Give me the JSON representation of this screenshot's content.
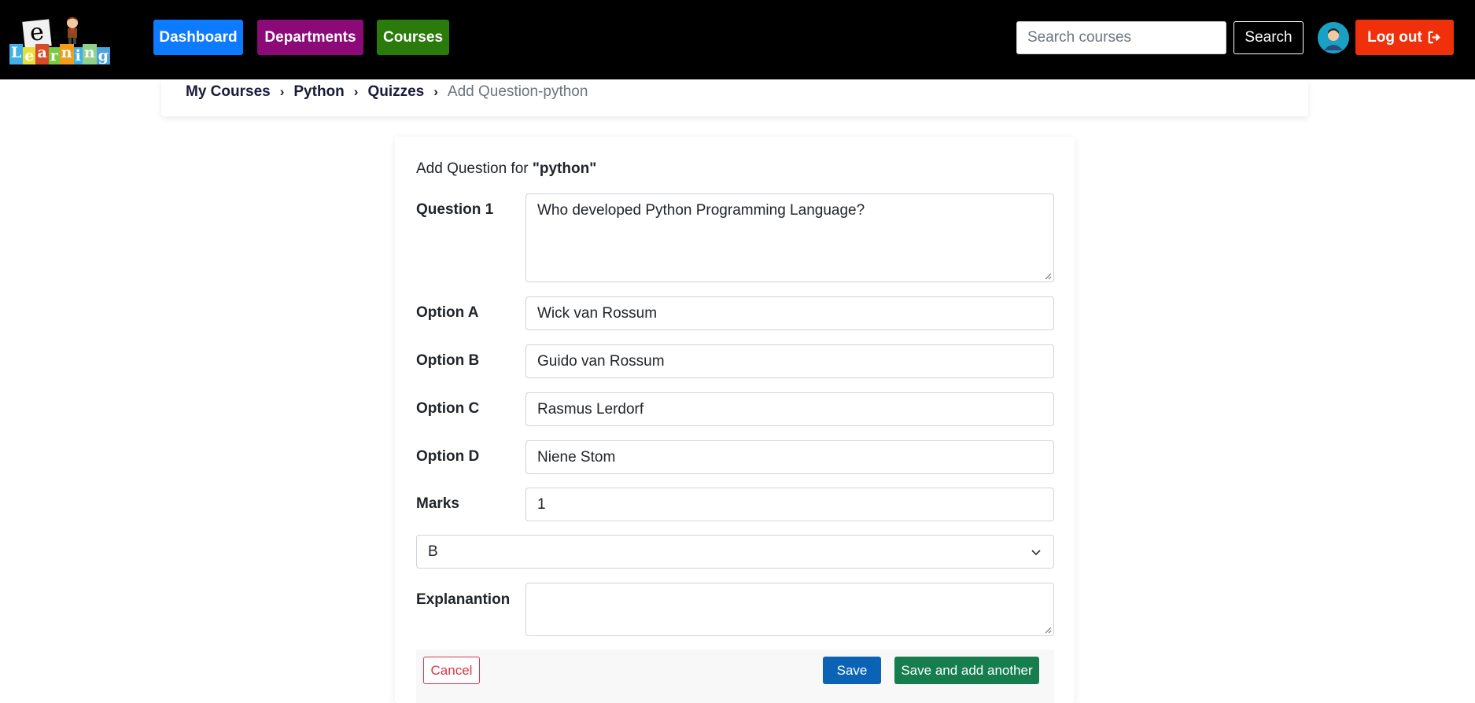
{
  "header": {
    "logo": {
      "letter": "e",
      "word": [
        "L",
        "e",
        "a",
        "r",
        "n",
        "i",
        "n",
        "g"
      ],
      "word_colors": [
        "#3fb0e8",
        "#e8e03a",
        "#d94a2a",
        "#7ac943",
        "#f29b1c",
        "#3fb0e8",
        "#8fd18a",
        "#4aa3df"
      ]
    },
    "nav": [
      {
        "label": "Dashboard",
        "color": "#0d7bff"
      },
      {
        "label": "Departments",
        "color": "#8c0a78"
      },
      {
        "label": "Courses",
        "color": "#2a7a0c"
      }
    ],
    "search": {
      "placeholder": "Search courses",
      "value": "",
      "button_label": "Search"
    },
    "avatar_icon": "user-avatar-icon",
    "logout": {
      "label": "Log out",
      "icon": "sign-out-icon",
      "color": "#f0300b"
    }
  },
  "breadcrumb": {
    "items": [
      "My Courses",
      "Python",
      "Quizzes"
    ],
    "current": "Add Question-python"
  },
  "form": {
    "title_prefix": "Add Question for",
    "title_course": "\"python\"",
    "question_label": "Question 1",
    "question_value": "Who developed Python Programming Language?",
    "options": [
      {
        "label": "Option A",
        "value": "Wick van Rossum"
      },
      {
        "label": "Option B",
        "value": "Guido van Rossum"
      },
      {
        "label": "Option C",
        "value": "Rasmus Lerdorf"
      },
      {
        "label": "Option D",
        "value": "Niene Stom"
      }
    ],
    "marks_label": "Marks",
    "marks_value": "1",
    "answer_selected": "B",
    "explanation_label": "Explanantion",
    "explanation_value": "",
    "buttons": {
      "cancel": "Cancel",
      "save": "Save",
      "save_add": "Save and add another"
    }
  }
}
